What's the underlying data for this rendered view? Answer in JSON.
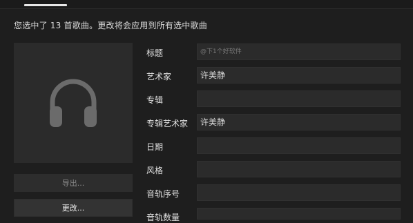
{
  "info_text": "您选中了 13 首歌曲。更改将会应用到所有选中歌曲",
  "buttons": {
    "export": "导出...",
    "change": "更改..."
  },
  "fields": [
    {
      "label": "标题",
      "value": "",
      "placeholder": "@下1个好软件"
    },
    {
      "label": "艺术家",
      "value": "许美静",
      "placeholder": ""
    },
    {
      "label": "专辑",
      "value": "",
      "placeholder": ""
    },
    {
      "label": "专辑艺术家",
      "value": "许美静",
      "placeholder": ""
    },
    {
      "label": "日期",
      "value": "",
      "placeholder": ""
    },
    {
      "label": "风格",
      "value": "",
      "placeholder": ""
    },
    {
      "label": "音轨序号",
      "value": "",
      "placeholder": ""
    },
    {
      "label": "音轨数量",
      "value": "",
      "placeholder": ""
    }
  ],
  "icons": {
    "album_art": "headphones-icon"
  },
  "colors": {
    "background": "#1e1e1e",
    "field": "#2b2b2b",
    "icon": "#6b6b6b"
  }
}
